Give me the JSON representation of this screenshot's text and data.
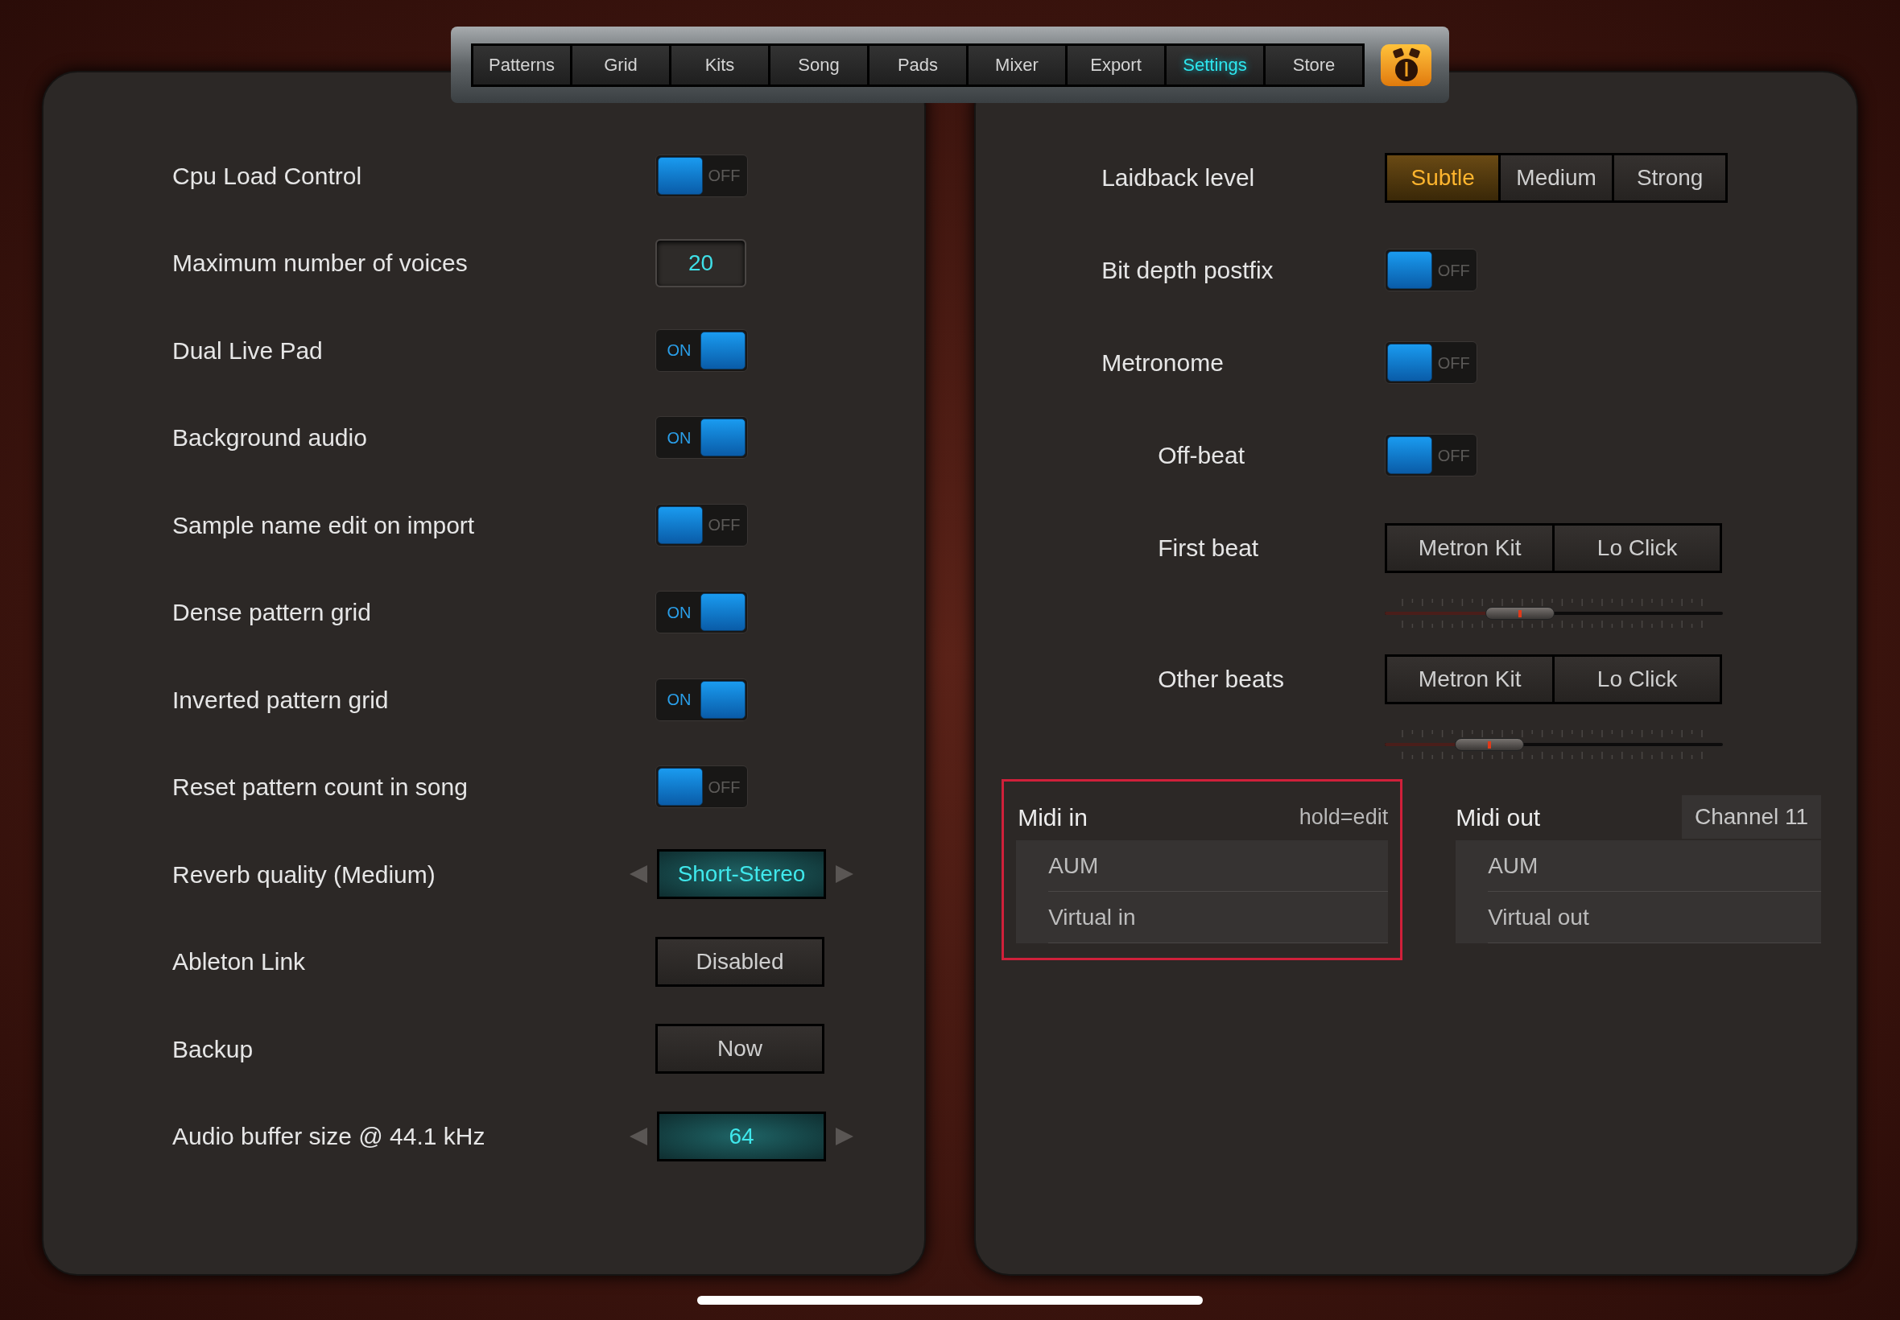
{
  "tabs": [
    {
      "label": "Patterns",
      "selected": false
    },
    {
      "label": "Grid",
      "selected": false
    },
    {
      "label": "Kits",
      "selected": false
    },
    {
      "label": "Song",
      "selected": false
    },
    {
      "label": "Pads",
      "selected": false
    },
    {
      "label": "Mixer",
      "selected": false
    },
    {
      "label": "Export",
      "selected": false
    },
    {
      "label": "Settings",
      "selected": true
    },
    {
      "label": "Store",
      "selected": false
    }
  ],
  "left_settings": [
    {
      "kind": "toggle",
      "label": "Cpu Load Control",
      "on": false,
      "state_label": "OFF"
    },
    {
      "kind": "number",
      "label": "Maximum number of voices",
      "value": "20"
    },
    {
      "kind": "toggle",
      "label": "Dual Live Pad",
      "on": true,
      "state_label": "ON"
    },
    {
      "kind": "toggle",
      "label": "Background audio",
      "on": true,
      "state_label": "ON"
    },
    {
      "kind": "toggle",
      "label": "Sample name edit on import",
      "on": false,
      "state_label": "OFF"
    },
    {
      "kind": "toggle",
      "label": "Dense pattern grid",
      "on": true,
      "state_label": "ON"
    },
    {
      "kind": "toggle",
      "label": "Inverted pattern grid",
      "on": true,
      "state_label": "ON"
    },
    {
      "kind": "toggle",
      "label": "Reset pattern count in song",
      "on": false,
      "state_label": "OFF"
    },
    {
      "kind": "selector",
      "label": "Reverb quality (Medium)",
      "value": "Short-Stereo"
    },
    {
      "kind": "button",
      "label": "Ableton Link",
      "value": "Disabled"
    },
    {
      "kind": "button",
      "label": "Backup",
      "value": "Now"
    },
    {
      "kind": "selector",
      "label": "Audio buffer size @ 44.1 kHz",
      "value": "64"
    }
  ],
  "right_settings": [
    {
      "kind": "segmented",
      "label": "Laidback level",
      "options": [
        {
          "label": "Subtle",
          "selected": true
        },
        {
          "label": "Medium",
          "selected": false
        },
        {
          "label": "Strong",
          "selected": false
        }
      ]
    },
    {
      "kind": "toggle",
      "label": "Bit depth postfix",
      "on": false,
      "state_label": "OFF"
    },
    {
      "kind": "toggle",
      "label": "Metronome",
      "on": false,
      "state_label": "OFF",
      "children": [
        {
          "kind": "toggle",
          "label": "Off-beat",
          "on": false,
          "state_label": "OFF"
        },
        {
          "kind": "segmented",
          "label": "First beat",
          "options": [
            {
              "label": "Metron Kit",
              "selected": false
            },
            {
              "label": "Lo Click",
              "selected": false
            }
          ],
          "level": 0.4
        },
        {
          "kind": "segmented",
          "label": "Other beats",
          "options": [
            {
              "label": "Metron Kit",
              "selected": false
            },
            {
              "label": "Lo Click",
              "selected": false
            }
          ],
          "level": 0.31
        }
      ]
    }
  ],
  "midi_in": {
    "title": "Midi in",
    "hint": "hold=edit",
    "selected": true,
    "ports": [
      "AUM",
      "Virtual in"
    ]
  },
  "midi_out": {
    "title": "Midi out",
    "channel": "Channel 11",
    "ports": [
      "AUM",
      "Virtual out"
    ]
  }
}
